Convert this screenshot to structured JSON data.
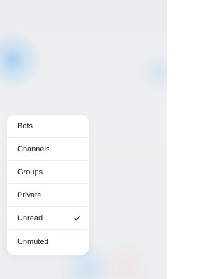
{
  "filter_menu": {
    "items": [
      {
        "label": "Bots",
        "checked": false
      },
      {
        "label": "Channels",
        "checked": false
      },
      {
        "label": "Groups",
        "checked": false
      },
      {
        "label": "Private",
        "checked": false
      },
      {
        "label": "Unread",
        "checked": true
      },
      {
        "label": "Unmuted",
        "checked": false
      }
    ],
    "check_icon": "checkmark-icon"
  }
}
